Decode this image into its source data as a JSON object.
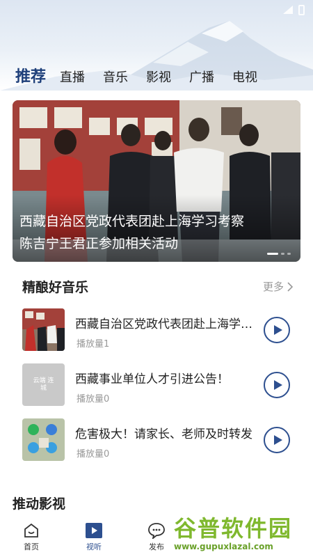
{
  "tabs": [
    {
      "label": "推荐",
      "active": true
    },
    {
      "label": "直播",
      "active": false
    },
    {
      "label": "音乐",
      "active": false
    },
    {
      "label": "影视",
      "active": false
    },
    {
      "label": "广播",
      "active": false
    },
    {
      "label": "电视",
      "active": false
    }
  ],
  "banner": {
    "caption_line1": "西藏自治区党政代表团赴上海学习考察",
    "caption_line2": "陈吉宁王君正参加相关活动"
  },
  "music_section": {
    "title": "精酿好音乐",
    "more_label": "更多",
    "items": [
      {
        "title": "西藏自治区党政代表团赴上海学习考察陈吉宁王君正参加相关活动",
        "plays": "播放量1"
      },
      {
        "title": "西藏事业单位人才引进公告！",
        "plays": "播放量0",
        "thumb_text": "云端 连城"
      },
      {
        "title": "危害极大！请家长、老师及时转发",
        "plays": "播放量0"
      }
    ]
  },
  "video_section": {
    "title": "推动影视"
  },
  "bottom_nav": [
    {
      "label": "首页",
      "icon": "home-icon",
      "active": false
    },
    {
      "label": "视听",
      "icon": "play-square-icon",
      "active": true
    },
    {
      "label": "发布",
      "icon": "chat-bubble-icon",
      "active": false
    }
  ],
  "watermark": {
    "brand": "谷普软件园",
    "url": "www.gupuxlazal.com"
  },
  "colors": {
    "accent": "#2d4f8f",
    "tab_active": "#1e3f7a",
    "watermark": "#7fb82e"
  }
}
